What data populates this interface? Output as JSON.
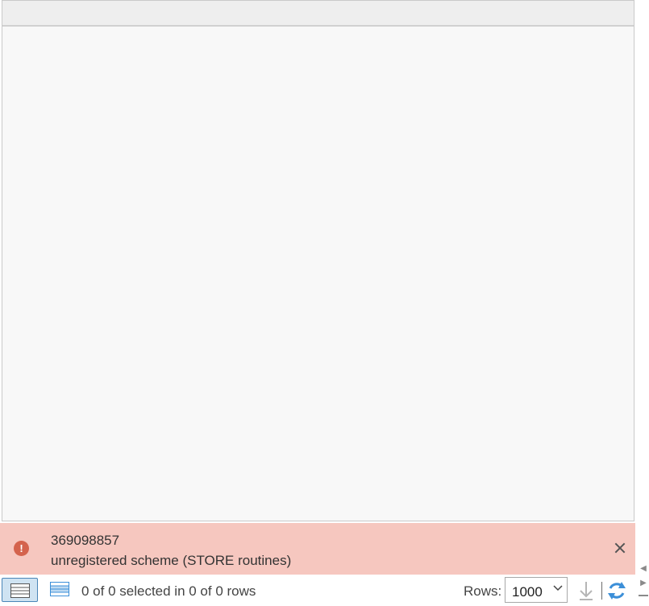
{
  "notification": {
    "code": "369098857",
    "message": "unregistered scheme (STORE routines)",
    "icon": "error-icon",
    "close_icon": "close-icon",
    "background_color": "#f6c7bf",
    "icon_color": "#d4634d"
  },
  "status_bar": {
    "selection_summary": "0 of 0 selected in 0 of 0 rows",
    "rows_label": "Rows:",
    "rows_value": "1000",
    "icons": [
      "show-all-records-icon",
      "show-selected-records-icon",
      "download-icon",
      "refresh-icon"
    ],
    "accent_color": "#3c8fd8"
  },
  "scroll_controls": {
    "left_icon": "scroll-left-icon",
    "right_icon": "scroll-right-icon"
  }
}
